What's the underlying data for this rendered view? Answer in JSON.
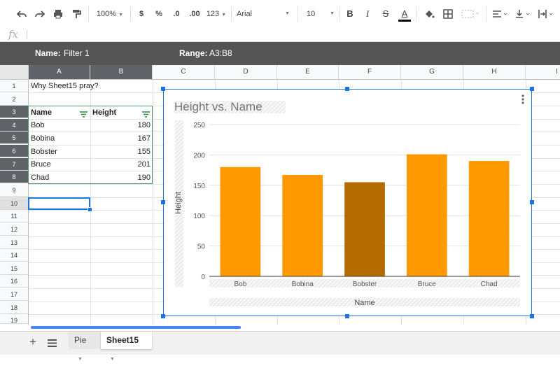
{
  "toolbar": {
    "zoom": "100%",
    "currency": "$",
    "percent": "%",
    "decrease_decimals": ".0",
    "increase_decimals": ".00",
    "more_formats": "123",
    "font": "Arial",
    "font_size": "10",
    "bold": "B",
    "italic": "I",
    "strikethrough": "S",
    "text_color": "A"
  },
  "formula_bar": {
    "fx": "fx",
    "value": ""
  },
  "filter_bar": {
    "name_label": "Name:",
    "name_value": "Filter 1",
    "range_label": "Range:",
    "range_value": "A3:B8"
  },
  "columns": [
    "A",
    "B",
    "C",
    "D",
    "E",
    "F",
    "G",
    "H",
    "I"
  ],
  "rows": [
    "1",
    "2",
    "3",
    "4",
    "5",
    "6",
    "7",
    "8",
    "9",
    "10",
    "11",
    "12",
    "13",
    "14",
    "15",
    "16",
    "17",
    "18",
    "19"
  ],
  "sheet": {
    "a1": "Why Sheet15 pray?",
    "header": {
      "name": "Name",
      "height": "Height"
    },
    "data": [
      {
        "name": "Bob",
        "height": "180"
      },
      {
        "name": "Bobina",
        "height": "167"
      },
      {
        "name": "Bobster",
        "height": "155"
      },
      {
        "name": "Bruce",
        "height": "201"
      },
      {
        "name": "Chad",
        "height": "190"
      }
    ]
  },
  "chart_data": {
    "type": "bar",
    "title": "Height vs. Name",
    "xlabel": "Name",
    "ylabel": "Height",
    "categories": [
      "Bob",
      "Bobina",
      "Bobster",
      "Bruce",
      "Chad"
    ],
    "values": [
      180,
      167,
      155,
      201,
      190
    ],
    "ylim": [
      0,
      250
    ],
    "yticks": [
      0,
      50,
      100,
      150,
      200,
      250
    ],
    "grid": true,
    "bar_color": "#ff9900",
    "highlight_color": "#b36b00",
    "highlighted_index": 2
  },
  "tabs": [
    {
      "label": "Pie",
      "active": false
    },
    {
      "label": "Sheet15",
      "active": true
    }
  ],
  "colors": {
    "accent": "#1a73e8",
    "filter_bar": "#555555",
    "header_dark": "#5f6368"
  }
}
